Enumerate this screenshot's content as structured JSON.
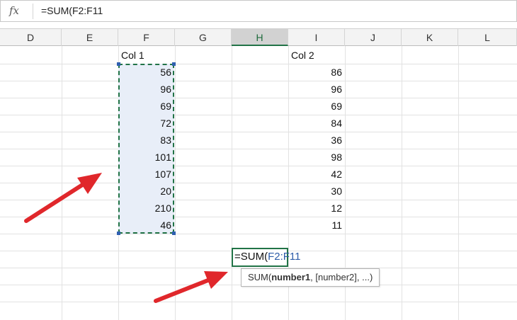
{
  "formula_bar": {
    "fx_label": "fx",
    "formula": "=SUM(F2:F11"
  },
  "columns": [
    "D",
    "E",
    "F",
    "G",
    "H",
    "I",
    "J",
    "K",
    "L"
  ],
  "active_column": "H",
  "col1": {
    "header": "Col 1",
    "values": [
      "56",
      "96",
      "69",
      "72",
      "83",
      "101",
      "107",
      "20",
      "210",
      "46"
    ]
  },
  "col2": {
    "header": "Col 2",
    "values": [
      "86",
      "96",
      "69",
      "84",
      "36",
      "98",
      "42",
      "30",
      "12",
      "11"
    ]
  },
  "active_cell": {
    "prefix": "=SUM(",
    "range_ref": "F2:F11"
  },
  "tooltip": {
    "func": "SUM(",
    "arg_bold": "number1",
    "rest": ", [number2], ...)"
  },
  "colors": {
    "accent_green": "#217346",
    "selection_fill": "#e8eef8",
    "ref_blue": "#2d5ca8",
    "arrow_red": "#e0272b"
  }
}
